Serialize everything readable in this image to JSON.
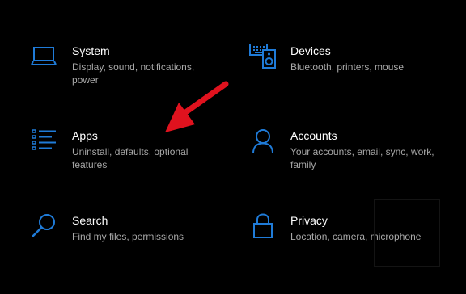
{
  "settings": {
    "tiles": [
      {
        "icon": "laptop-icon",
        "title": "System",
        "description": "Display, sound, notifications, power"
      },
      {
        "icon": "keyboard-speaker-icon",
        "title": "Devices",
        "description": "Bluetooth, printers, mouse"
      },
      {
        "icon": "apps-list-icon",
        "title": "Apps",
        "description": "Uninstall, defaults, optional features"
      },
      {
        "icon": "person-icon",
        "title": "Accounts",
        "description": "Your accounts, email, sync, work, family"
      },
      {
        "icon": "search-icon",
        "title": "Search",
        "description": "Find my files, permissions"
      },
      {
        "icon": "lock-icon",
        "title": "Privacy",
        "description": "Location, camera, microphone"
      }
    ]
  },
  "colors": {
    "background": "#000000",
    "accent": "#1f7bd8",
    "title": "#ffffff",
    "description": "#a8a8a8",
    "annotation_arrow": "#e0121e"
  }
}
